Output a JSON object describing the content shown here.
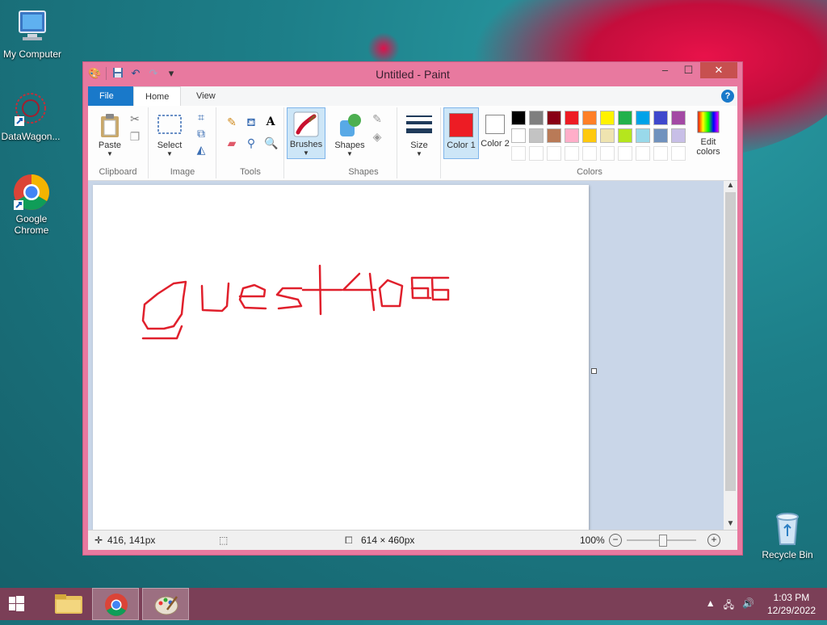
{
  "desktop": {
    "icons": [
      {
        "label": "My Computer"
      },
      {
        "label": "DataWagon..."
      },
      {
        "label": "Google Chrome"
      },
      {
        "label": "Recycle Bin"
      }
    ]
  },
  "window": {
    "title": "Untitled - Paint",
    "controls": {
      "minimize": "–",
      "maximize": "☐",
      "close": "✕"
    },
    "tabs": {
      "file": "File",
      "home": "Home",
      "view": "View"
    },
    "help": "?"
  },
  "ribbon": {
    "clipboard": {
      "paste": "Paste",
      "label": "Clipboard"
    },
    "image": {
      "select": "Select",
      "label": "Image"
    },
    "tools": {
      "label": "Tools"
    },
    "brushes": {
      "label": "Brushes"
    },
    "shapes": {
      "shapes": "Shapes",
      "label": "Shapes"
    },
    "size": {
      "label": "Size"
    },
    "colors": {
      "color1": "Color 1",
      "color2": "Color 2",
      "edit": "Edit colors",
      "label": "Colors",
      "color1_value": "#ed1c24",
      "color2_value": "#ffffff",
      "row1": [
        "#000000",
        "#7f7f7f",
        "#880015",
        "#ed1c24",
        "#ff7f27",
        "#fff200",
        "#22b14c",
        "#00a2e8",
        "#3f48cc",
        "#a349a4"
      ],
      "row2": [
        "#ffffff",
        "#c3c3c3",
        "#b97a57",
        "#ffaec9",
        "#ffc90e",
        "#efe4b0",
        "#b5e61d",
        "#99d9ea",
        "#7092be",
        "#c8bfe7"
      ]
    }
  },
  "canvas": {
    "stroke_color": "#e0202c"
  },
  "status": {
    "cursor": "416, 141px",
    "size": "614 × 460px",
    "zoom": "100%"
  },
  "taskbar": {
    "time": "1:03 PM",
    "date": "12/29/2022"
  }
}
